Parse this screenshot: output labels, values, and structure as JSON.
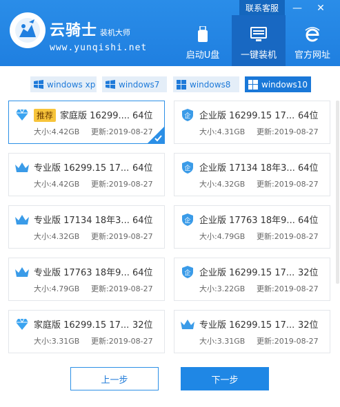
{
  "brand": {
    "name": "云骑士",
    "subtitle": "装机大师",
    "url": "www.yunqishi.net"
  },
  "header": {
    "support_label": "联系客服",
    "minimize_glyph": "—",
    "close_glyph": "✕",
    "nav": [
      {
        "label": "启动U盘",
        "icon": "usb-icon"
      },
      {
        "label": "一键装机",
        "icon": "computer-icon",
        "active": true
      },
      {
        "label": "官方网址",
        "icon": "ie-browser-icon"
      }
    ]
  },
  "os_tabs": [
    {
      "label": "windows xp",
      "active": false
    },
    {
      "label": "windows7",
      "active": false
    },
    {
      "label": "windows8",
      "active": false
    },
    {
      "label": "windows10",
      "active": true
    }
  ],
  "systems": [
    {
      "badge": "推荐",
      "title": "家庭版 16299....",
      "bits": "64位",
      "size": "大小:4.42GB",
      "date": "更新:2019-08-27",
      "icon": "diamond-icon",
      "selected": true
    },
    {
      "badge": "",
      "title": "企业版 16299.15 17...",
      "bits": "64位",
      "size": "大小:4.31GB",
      "date": "更新:2019-08-27",
      "icon": "shield-icon",
      "selected": false
    },
    {
      "badge": "",
      "title": "专业版 16299.15 17...",
      "bits": "64位",
      "size": "大小:4.42GB",
      "date": "更新:2019-08-27",
      "icon": "crown-icon",
      "selected": false
    },
    {
      "badge": "",
      "title": "企业版 17134 18年3...",
      "bits": "64位",
      "size": "大小:4.32GB",
      "date": "更新:2019-08-27",
      "icon": "shield-icon",
      "selected": false
    },
    {
      "badge": "",
      "title": "专业版 17134 18年3...",
      "bits": "64位",
      "size": "大小:4.32GB",
      "date": "更新:2019-08-27",
      "icon": "crown-icon",
      "selected": false
    },
    {
      "badge": "",
      "title": "企业版 17763 18年9...",
      "bits": "64位",
      "size": "大小:4.79GB",
      "date": "更新:2019-08-27",
      "icon": "shield-icon",
      "selected": false
    },
    {
      "badge": "",
      "title": "专业版 17763 18年9...",
      "bits": "64位",
      "size": "大小:4.79GB",
      "date": "更新:2019-08-27",
      "icon": "crown-icon",
      "selected": false
    },
    {
      "badge": "",
      "title": "企业版 16299.15 17...",
      "bits": "32位",
      "size": "大小:3.22GB",
      "date": "更新:2019-08-27",
      "icon": "shield-icon",
      "selected": false
    },
    {
      "badge": "",
      "title": "家庭版 16299.15 17...",
      "bits": "32位",
      "size": "大小:3.31GB",
      "date": "更新:2019-08-27",
      "icon": "diamond-icon",
      "selected": false
    },
    {
      "badge": "",
      "title": "专业版 16299.15 17...",
      "bits": "32位",
      "size": "大小:3.31GB",
      "date": "更新:2019-08-27",
      "icon": "crown-icon",
      "selected": false
    }
  ],
  "buttons": {
    "prev": "上一步",
    "next": "下一步"
  },
  "colors": {
    "header_blue": "#2a8de8",
    "accent": "#1f87e5",
    "badge_yellow": "#f7c43a",
    "card_border": "#e3e6ea"
  }
}
